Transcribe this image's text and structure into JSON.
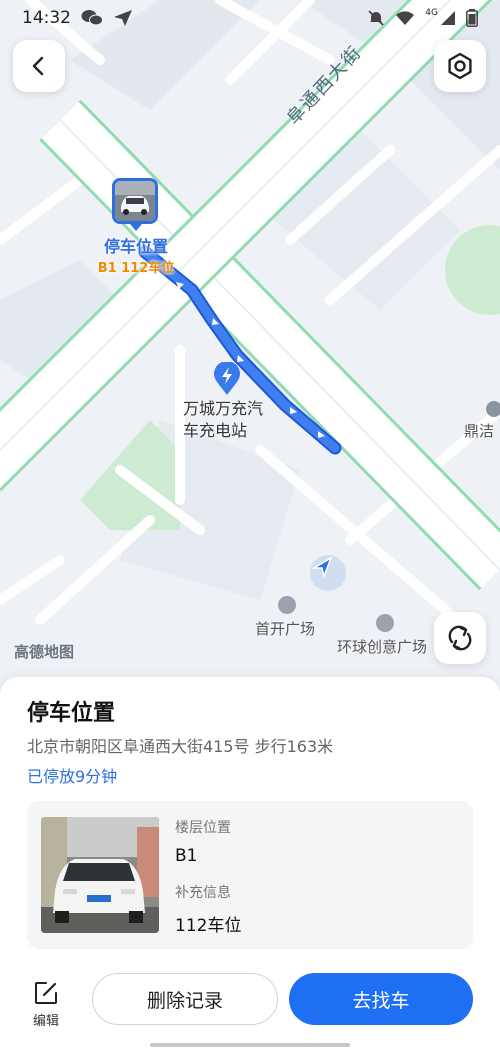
{
  "status_bar": {
    "time": "14:32",
    "network": "4G",
    "icons": [
      "wechat-icon",
      "send-icon",
      "mute-icon",
      "wifi-icon",
      "signal-icon",
      "battery-icon"
    ]
  },
  "map": {
    "road_name": "阜通西大街",
    "parking_title": "停车位置",
    "parking_sub": "B1 112车位",
    "poi_charging_line1": "万城万充汽",
    "poi_charging_line2": "车充电站",
    "poi_plaza": "首开广场",
    "poi_creative": "环球创意广场",
    "poi_partial": "鼎洁",
    "logo": "高德地图"
  },
  "sheet": {
    "title": "停车位置",
    "address": "北京市朝阳区阜通西大街415号  步行163米",
    "duration": "已停放9分钟",
    "floor_label": "楼层位置",
    "floor_value": "B1",
    "extra_label": "补充信息",
    "extra_value": "112车位"
  },
  "actions": {
    "edit_label": "编辑",
    "delete_label": "删除记录",
    "find_label": "去找车"
  },
  "colors": {
    "accent": "#1f6ff2",
    "route": "#2f6fe0",
    "road_green": "#8fdcae",
    "parking_orange": "#f08a00"
  }
}
